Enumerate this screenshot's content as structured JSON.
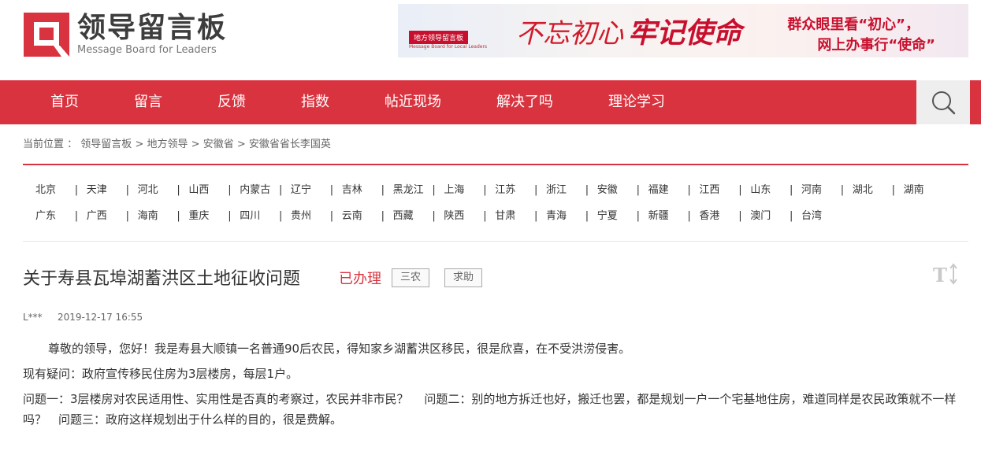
{
  "header": {
    "logo_title": "领导留言板",
    "logo_subtitle": "Message Board for Leaders",
    "banner": {
      "tag": "地方领导留言板",
      "tag_sub": "Message Board for Local Leaders",
      "calligraphy1": "不忘初心",
      "calligraphy2": "牢记使命",
      "line1": "群众眼里看“初心”，",
      "line2": "网上办事行“使命”"
    }
  },
  "nav": {
    "items": [
      "首页",
      "留言",
      "反馈",
      "指数",
      "帖近现场",
      "解决了吗",
      "理论学习"
    ]
  },
  "breadcrumb": {
    "label": "当前位置 ：",
    "items": [
      "领导留言板",
      "地方领导",
      "安徽省",
      "安徽省省长李国英"
    ],
    "separator": ">"
  },
  "regions": {
    "row1": [
      "北京",
      "天津",
      "河北",
      "山西",
      "内蒙古",
      "辽宁",
      "吉林",
      "黑龙江",
      "上海",
      "江苏",
      "浙江",
      "安徽",
      "福建",
      "江西",
      "山东",
      "河南",
      "湖北",
      "湖南"
    ],
    "row2": [
      "广东",
      "广西",
      "海南",
      "重庆",
      "四川",
      "贵州",
      "云南",
      "西藏",
      "陕西",
      "甘肃",
      "青海",
      "宁夏",
      "新疆",
      "香港",
      "澳门",
      "台湾"
    ],
    "separator": "|"
  },
  "message": {
    "title": "关于寿县瓦埠湖蓄洪区土地征收问题",
    "status": "已办理",
    "tags": [
      "三农",
      "求助"
    ],
    "author": "L***",
    "date": "2019-12-17 16:55",
    "paragraphs": [
      "尊敬的领导，您好！我是寿县大顺镇一名普通90后农民，得知家乡湖蓄洪区移民，很是欣喜，在不受洪涝侵害。",
      "现有疑问：政府宣传移民住房为3层楼房，每层1户。",
      "问题一：3层楼房对农民适用性、实用性是否真的考察过，农民并非市民？　 问题二：别的地方拆迁也好，搬迁也罢，都是规划一户一个宅基地住房，难道同样是农民政策就不一样吗？　问题三：政府这样规划出于什么样的目的，很是费解。"
    ]
  },
  "icons": {
    "search": "search-icon",
    "font_size": "font-size-icon"
  },
  "colors": {
    "brand_red": "#d9333f",
    "status_red": "#d9333f"
  }
}
